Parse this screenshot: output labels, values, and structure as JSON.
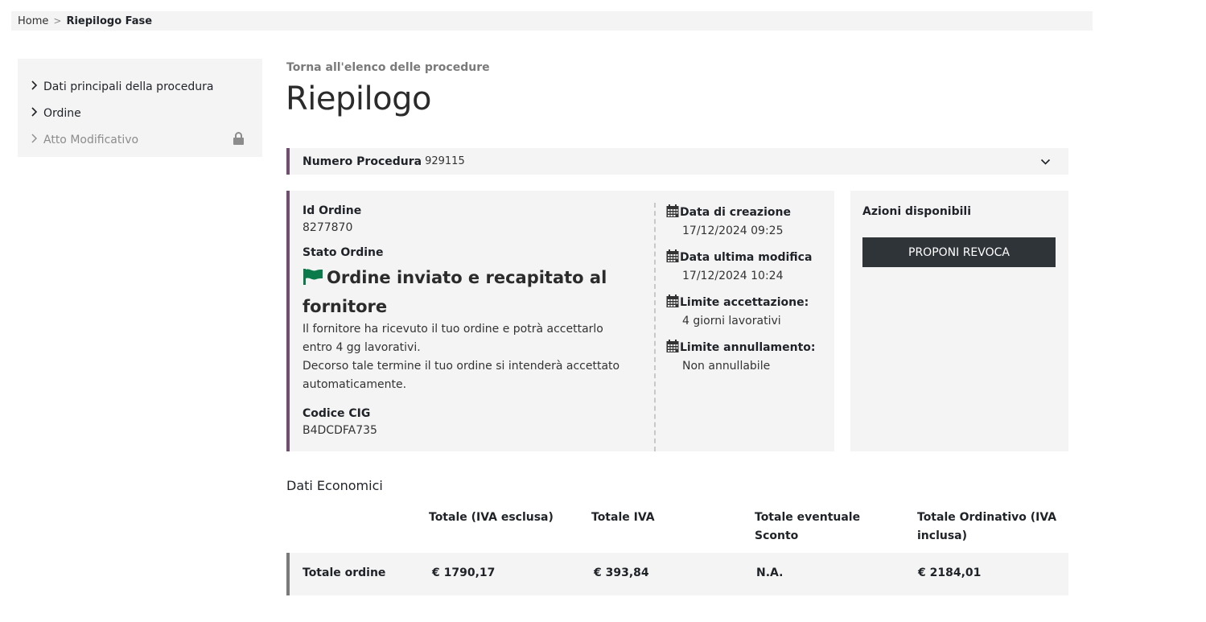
{
  "breadcrumb": {
    "home": "Home",
    "separator": ">",
    "current": "Riepilogo Fase"
  },
  "sidebar": {
    "items": [
      {
        "label": "Dati principali della procedura",
        "icon": "chevron-right-icon",
        "enabled": true
      },
      {
        "label": "Ordine",
        "icon": "chevron-right-icon",
        "enabled": true
      },
      {
        "label": "Atto Modificativo",
        "icon": "chevron-right-icon",
        "enabled": false,
        "trailing_icon": "lock-icon"
      }
    ]
  },
  "main": {
    "back_link": "Torna all'elenco delle procedure",
    "title": "Riepilogo",
    "procedure": {
      "label": "Numero Procedura",
      "value": "929115",
      "toggle_icon": "chevron-down-icon"
    },
    "order": {
      "id_label": "Id Ordine",
      "id_value": "8277870",
      "status_label": "Stato Ordine",
      "status_icon": "flag-icon",
      "status_text": "Ordine inviato e recapitato al fornitore",
      "status_desc_1": "Il fornitore ha ricevuto il tuo ordine e potrà accettarlo entro 4 gg lavorativi.",
      "status_desc_2": "Decorso tale termine il tuo ordine si intenderà accettato automaticamente.",
      "cig_label": "Codice CIG",
      "cig_value": "B4DCDFA735",
      "dates": [
        {
          "label": "Data di creazione",
          "value": "17/12/2024 09:25",
          "icon": "calendar-icon"
        },
        {
          "label": "Data ultima modifica",
          "value": "17/12/2024 10:24",
          "icon": "calendar-icon"
        },
        {
          "label": "Limite accettazione:",
          "value": "4 giorni lavorativi",
          "icon": "calendar-icon"
        },
        {
          "label": "Limite annullamento:",
          "value": "Non annullabile",
          "icon": "calendar-icon"
        }
      ]
    },
    "actions": {
      "title": "Azioni disponibili",
      "revoca_button": "PROPONI REVOCA"
    },
    "economics": {
      "title": "Dati Economici",
      "headers": [
        "Totale (IVA esclusa)",
        "Totale IVA",
        "Totale eventuale Sconto",
        "Totale Ordinativo (IVA inclusa)"
      ],
      "row": {
        "label": "Totale ordine",
        "values": [
          "€ 1790,17",
          "€ 393,84",
          "N.A.",
          "€ 2184,01"
        ]
      }
    }
  },
  "colors": {
    "accent_border": "#6e4f6e",
    "panel_bg": "#f4f4f4",
    "button_bg": "#2f3439",
    "flag_green": "#0a7a4a"
  }
}
